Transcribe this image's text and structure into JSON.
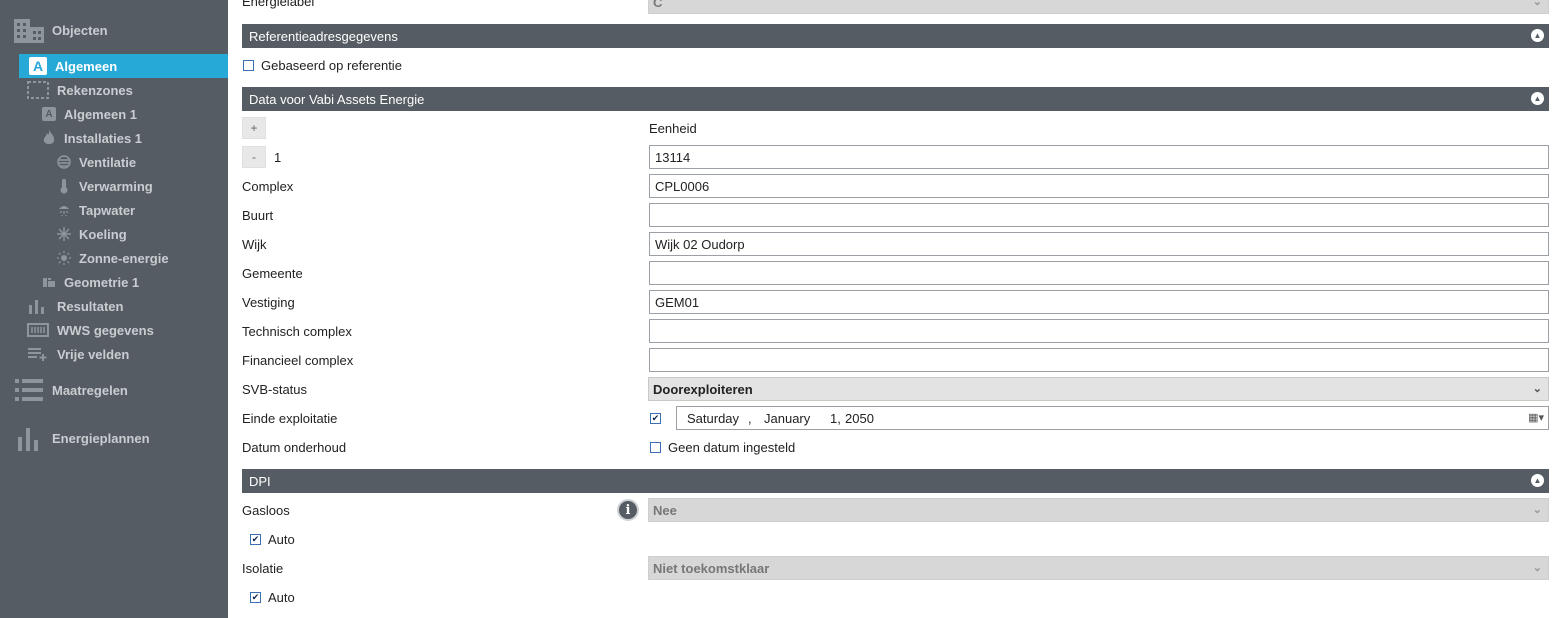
{
  "sidebar": {
    "items": [
      {
        "label": "Objecten",
        "icon": "building-icon"
      },
      {
        "label": "Algemeen",
        "icon": "a-icon",
        "active": true
      },
      {
        "label": "Rekenzones",
        "icon": "zones-icon"
      },
      {
        "label": "Algemeen 1",
        "icon": "a-icon"
      },
      {
        "label": "Installaties 1",
        "icon": "flame-icon"
      },
      {
        "label": "Ventilatie",
        "icon": "ventilation-icon"
      },
      {
        "label": "Verwarming",
        "icon": "thermometer-icon"
      },
      {
        "label": "Tapwater",
        "icon": "shower-icon"
      },
      {
        "label": "Koeling",
        "icon": "snowflake-icon"
      },
      {
        "label": "Zonne-energie",
        "icon": "sun-icon"
      },
      {
        "label": "Geometrie 1",
        "icon": "geometry-icon"
      },
      {
        "label": "Resultaten",
        "icon": "bar-chart-icon"
      },
      {
        "label": "WWS gegevens",
        "icon": "wws-icon"
      },
      {
        "label": "Vrije velden",
        "icon": "list-add-icon"
      },
      {
        "label": "Maatregelen",
        "icon": "list-icon"
      },
      {
        "label": "Energieplannen",
        "icon": "bar-chart-icon"
      }
    ]
  },
  "main": {
    "top_label": "Energielabel",
    "top_value": "C",
    "section_ref": "Referentieadresgegevens",
    "ref_checkbox_label": "Gebaseerd op referentie",
    "section_vabi": "Data voor Vabi Assets Energie",
    "plus_label": "+",
    "minus_label": "-",
    "row_number": "1",
    "column_header": "Eenheid",
    "eenheid_value": "13114",
    "fields": [
      {
        "label": "Complex",
        "value": "CPL0006"
      },
      {
        "label": "Buurt",
        "value": ""
      },
      {
        "label": "Wijk",
        "value": "Wijk 02 Oudorp"
      },
      {
        "label": "Gemeente",
        "value": ""
      },
      {
        "label": "Vestiging",
        "value": "GEM01"
      },
      {
        "label": "Technisch complex",
        "value": ""
      },
      {
        "label": "Financieel complex",
        "value": ""
      }
    ],
    "svb_label": "SVB-status",
    "svb_value": "Doorexploiteren",
    "einde_label": "Einde exploitatie",
    "einde_date": {
      "weekday": "Saturday",
      "comma": ",",
      "month": "January",
      "day": "1,",
      "year": "2050"
    },
    "onderhoud_label": "Datum onderhoud",
    "onderhoud_checkbox_label": "Geen datum ingesteld",
    "section_dpi": "DPI",
    "gasloos_label": "Gasloos",
    "gasloos_value": "Nee",
    "gasloos_auto": "Auto",
    "isolatie_label": "Isolatie",
    "isolatie_value": "Niet toekomstklaar",
    "isolatie_auto": "Auto",
    "info_glyph": "i"
  },
  "colors": {
    "sidebar_bg": "#555c63",
    "active": "#27a9d8",
    "header_bg": "#555c63"
  }
}
